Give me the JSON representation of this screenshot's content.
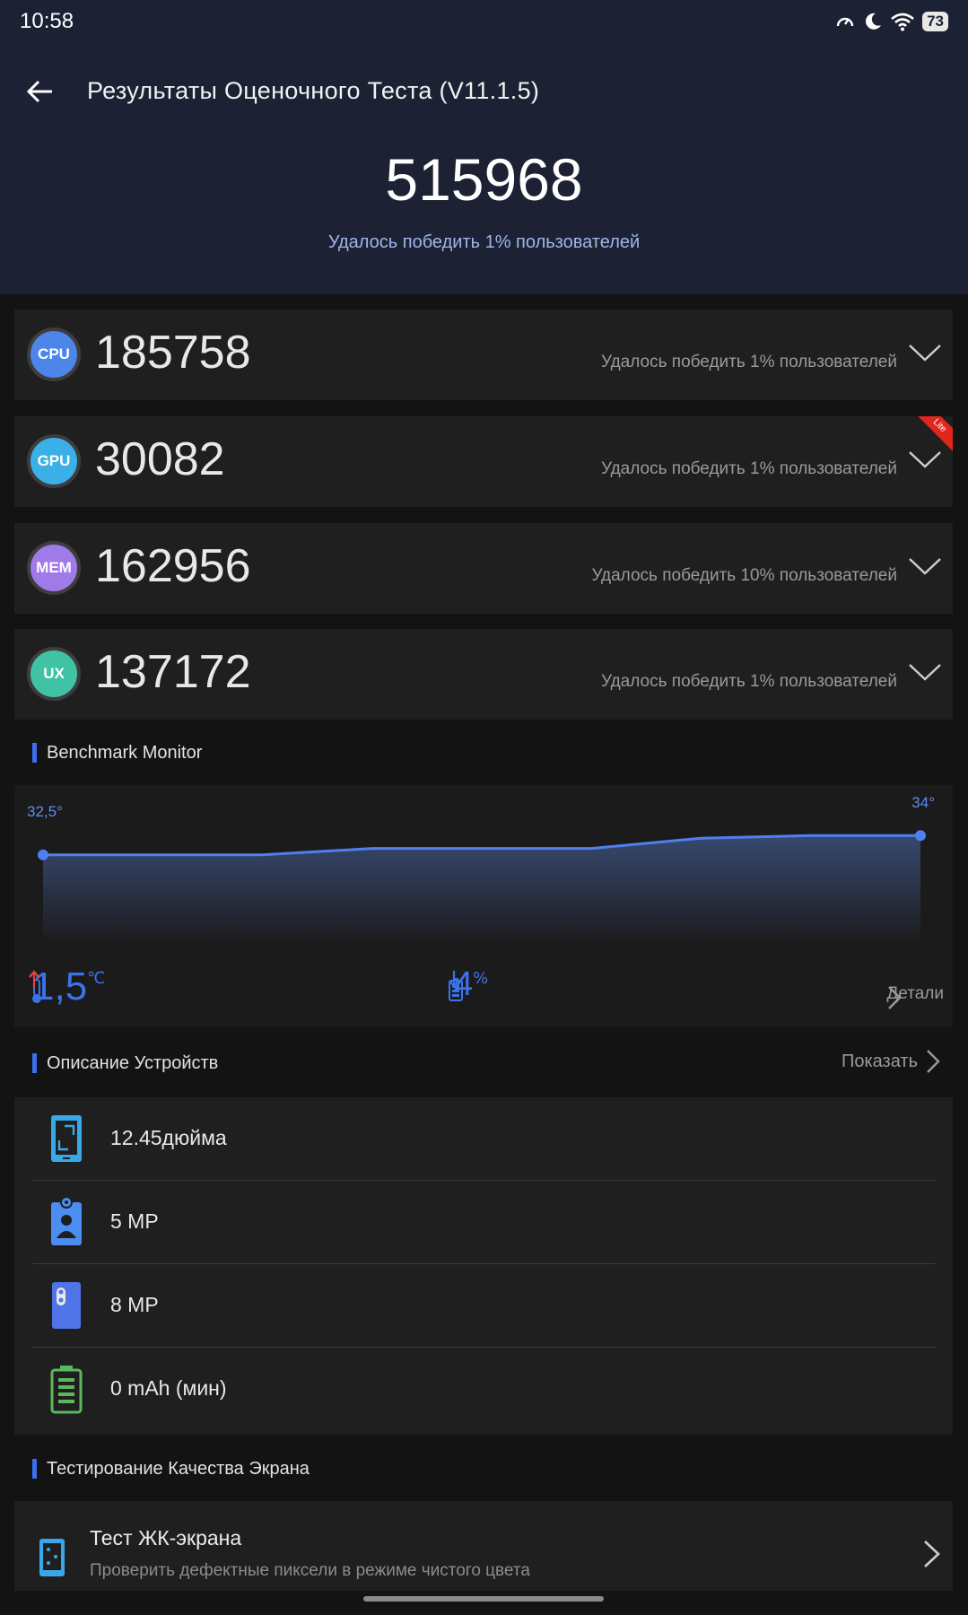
{
  "status_bar": {
    "time": "10:58",
    "battery": "73"
  },
  "header": {
    "title": "Результаты Оценочного Теста (V11.1.5)",
    "total_score": "515968",
    "total_subtitle": "Удалось победить 1% пользователей"
  },
  "scores": [
    {
      "badge": "CPU",
      "value": "185758",
      "subtitle": "Удалось победить 1% пользователей",
      "color": "#4b86e8"
    },
    {
      "badge": "GPU",
      "value": "30082",
      "subtitle": "Удалось победить 1% пользователей",
      "color": "#3ab0e6",
      "ribbon": "Lite"
    },
    {
      "badge": "MEM",
      "value": "162956",
      "subtitle": "Удалось победить 10% пользователей",
      "color": "#a07ae8"
    },
    {
      "badge": "UX",
      "value": "137172",
      "subtitle": "Удалось победить 1% пользователей",
      "color": "#3fc3a4"
    }
  ],
  "monitor": {
    "title": "Benchmark Monitor",
    "temp_start": "32,5°",
    "temp_end": "34°",
    "temp_delta": "1,5",
    "temp_unit": "℃",
    "battery_delta": "4",
    "battery_unit": "%",
    "details_label": "Детали",
    "accent": "#3b73ea"
  },
  "chart_data": {
    "type": "line",
    "x": [
      0,
      1,
      2,
      3,
      4,
      5,
      6,
      7,
      8
    ],
    "series": [
      {
        "values": [
          32.5,
          32.5,
          32.5,
          33.0,
          33.0,
          33.0,
          33.8,
          34.0,
          34.0
        ]
      }
    ],
    "ylim": [
      25,
      35
    ],
    "grid": false
  },
  "device": {
    "title": "Описание Устройств",
    "show_label": "Показать",
    "items": [
      {
        "icon": "tablet-screen-icon",
        "text": "12.45дюйма"
      },
      {
        "icon": "front-camera-icon",
        "text": "5 MP"
      },
      {
        "icon": "rear-camera-icon",
        "text": "8 MP"
      },
      {
        "icon": "battery-icon",
        "text": "0 mAh (мин)"
      }
    ]
  },
  "screen_quality": {
    "title": "Тестирование Качества Экрана",
    "lcd_title": "Тест ЖК-экрана",
    "lcd_subtitle": "Проверить дефектные пиксели в режиме чистого цвета"
  }
}
